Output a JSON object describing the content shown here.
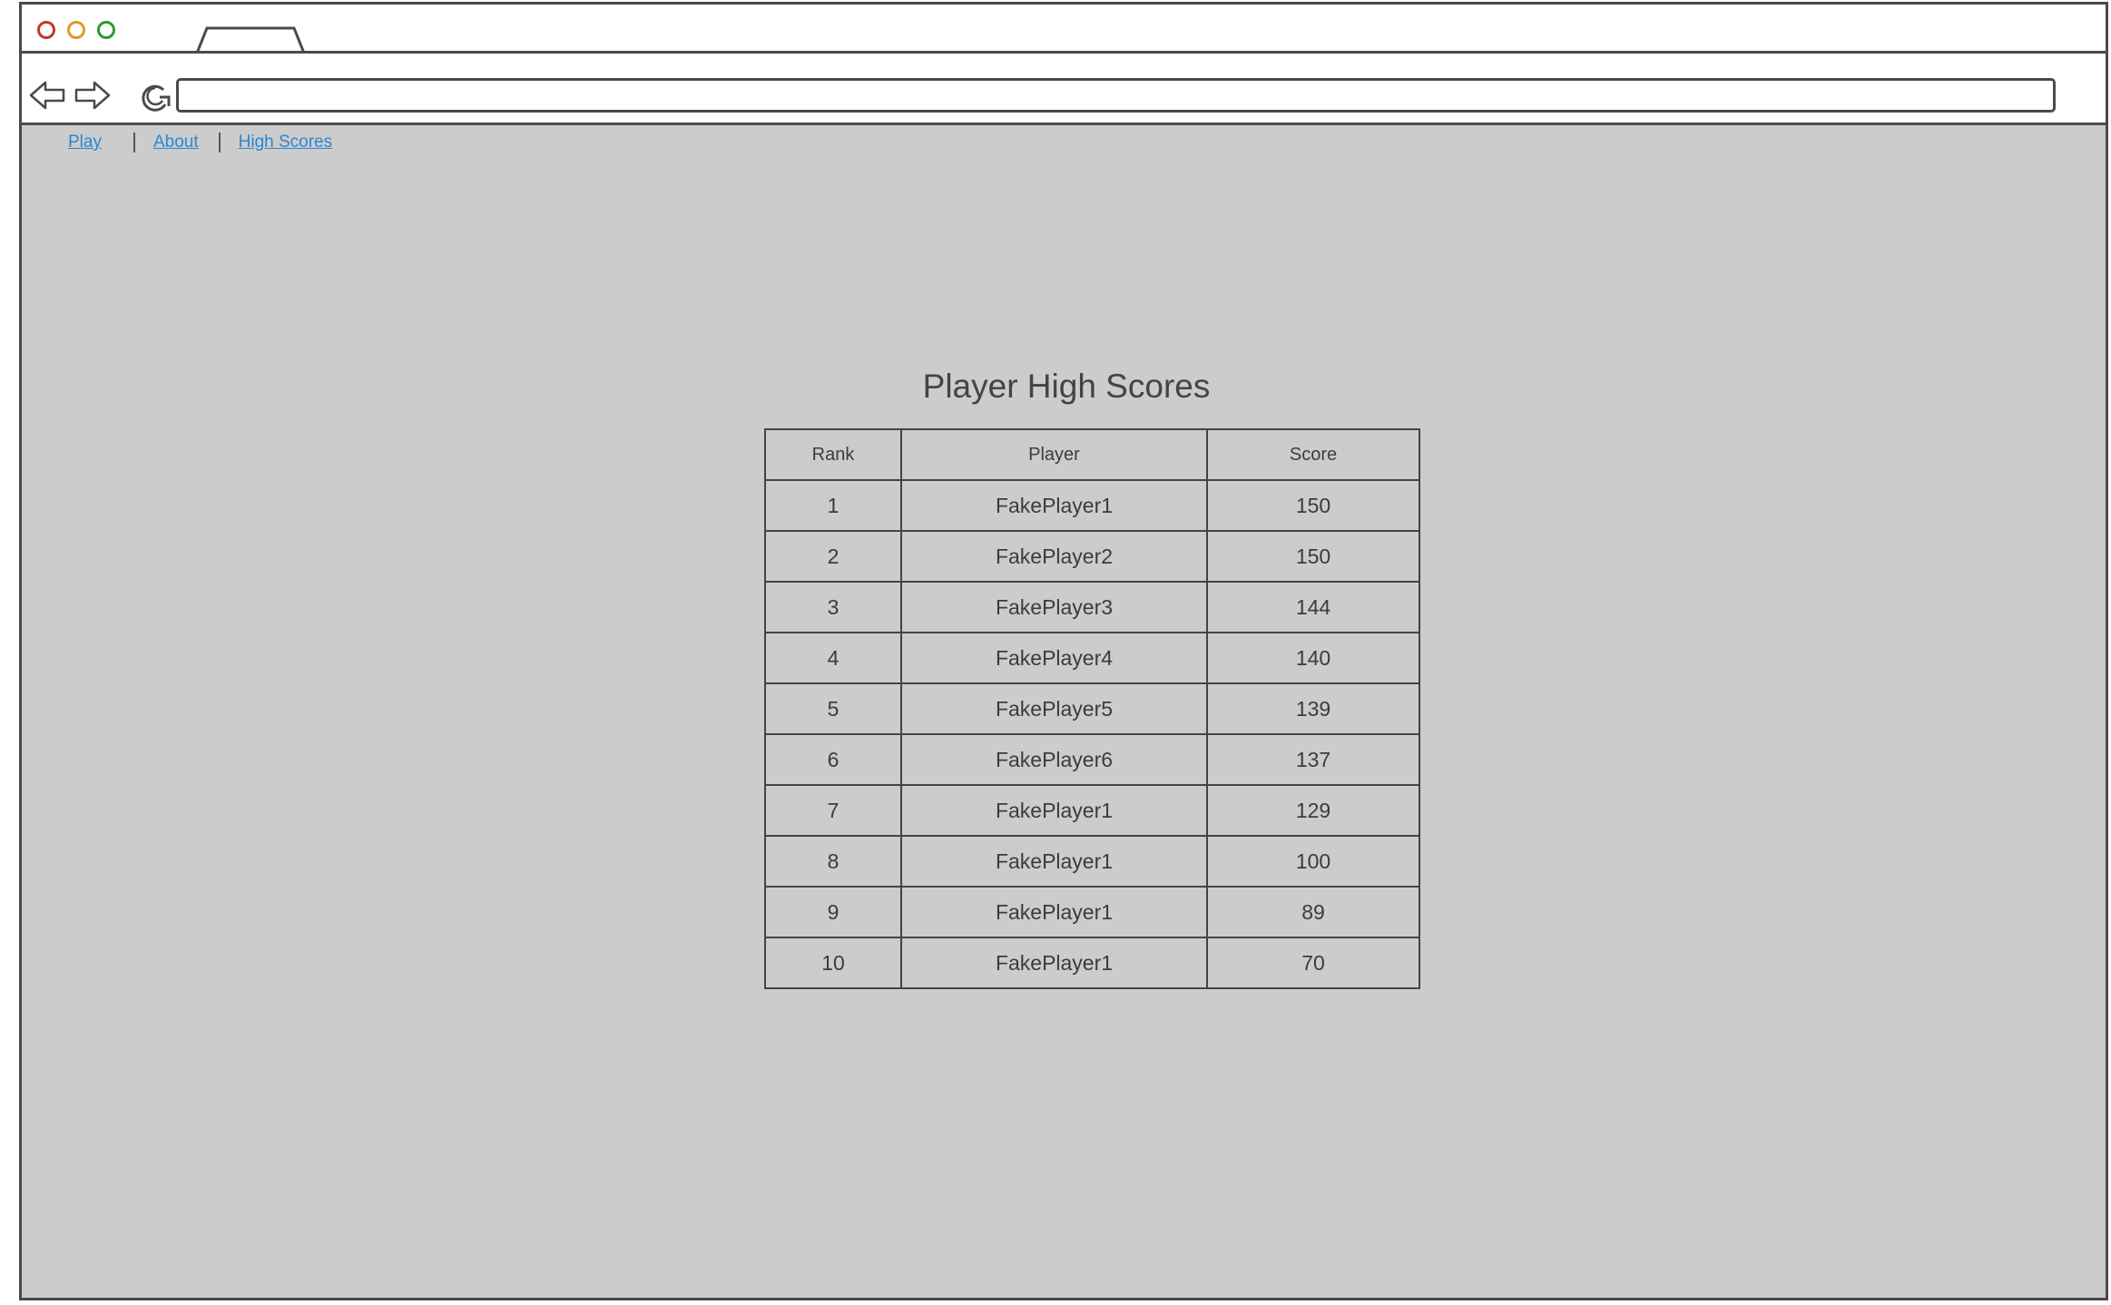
{
  "browser": {
    "address_value": "",
    "colors": {
      "close": "#c0392b",
      "minimize": "#e39a20",
      "maximize": "#2e9a2e"
    }
  },
  "nav": {
    "links": [
      {
        "label": "Play"
      },
      {
        "label": "About"
      },
      {
        "label": "High Scores"
      }
    ],
    "link_color": "#2b86d3"
  },
  "page": {
    "title": "Player High Scores"
  },
  "table": {
    "headers": {
      "rank": "Rank",
      "player": "Player",
      "score": "Score"
    },
    "rows": [
      {
        "rank": "1",
        "player": "FakePlayer1",
        "score": "150"
      },
      {
        "rank": "2",
        "player": "FakePlayer2",
        "score": "150"
      },
      {
        "rank": "3",
        "player": "FakePlayer3",
        "score": "144"
      },
      {
        "rank": "4",
        "player": "FakePlayer4",
        "score": "140"
      },
      {
        "rank": "5",
        "player": "FakePlayer5",
        "score": "139"
      },
      {
        "rank": "6",
        "player": "FakePlayer6",
        "score": "137"
      },
      {
        "rank": "7",
        "player": "FakePlayer1",
        "score": "129"
      },
      {
        "rank": "8",
        "player": "FakePlayer1",
        "score": "100"
      },
      {
        "rank": "9",
        "player": "FakePlayer1",
        "score": "89"
      },
      {
        "rank": "10",
        "player": "FakePlayer1",
        "score": "70"
      }
    ]
  }
}
